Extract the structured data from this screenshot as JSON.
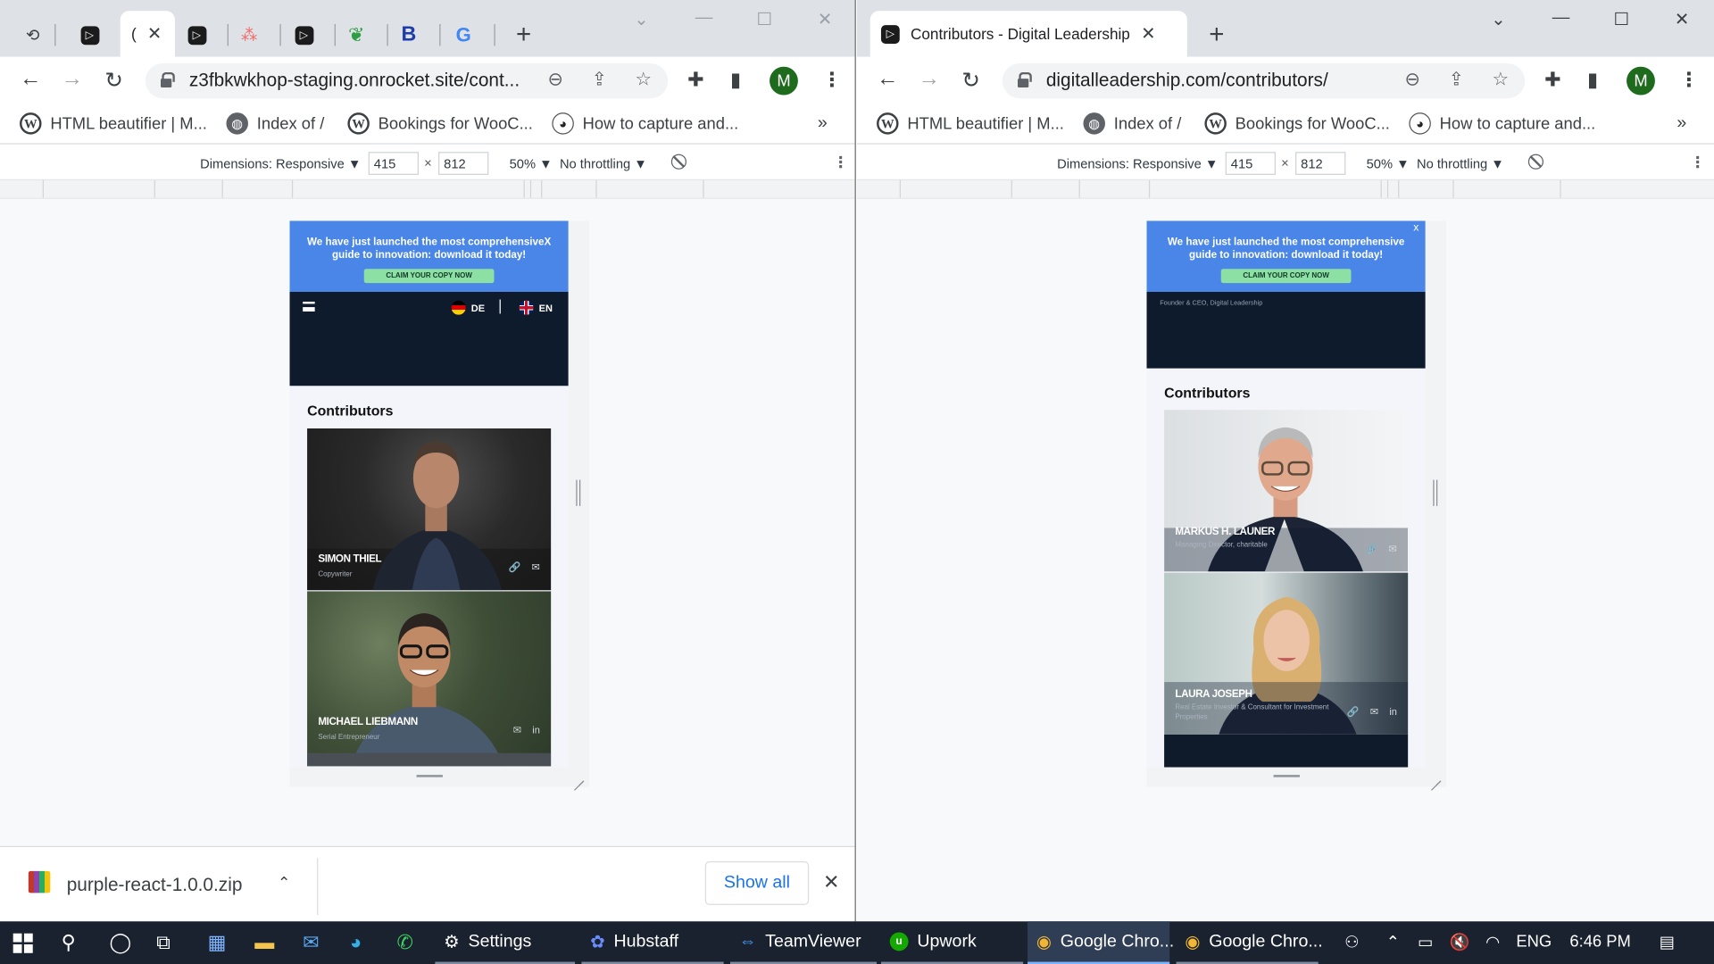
{
  "left_window": {
    "tabs": {
      "active_title": "(",
      "active_close": "✕",
      "bold_letter": "B",
      "g_letter": "G",
      "new_tab": "+"
    },
    "url": "z3fbkwkhop-staging.onrocket.site/cont...",
    "avatar_letter": "M",
    "bookmarks": [
      "HTML beautifier | M...",
      "Index of /",
      "Bookings for WooC...",
      "How to capture and..."
    ],
    "bookmark_more": "»",
    "devtools": {
      "dimensions": "Dimensions: Responsive ▼",
      "width": "415",
      "times": "×",
      "height": "812",
      "zoom": "50% ▼",
      "throttling": "No throttling ▼"
    },
    "page": {
      "banner_text": "We have just launched the most comprehensiveX guide to innovation: download it today!",
      "banner_button": "CLAIM YOUR COPY NOW",
      "lang_de": "DE",
      "lang_en": "EN",
      "section_title": "Contributors",
      "cards": [
        {
          "name": "SIMON THIEL",
          "role": "Copywriter",
          "icons": [
            "🔗",
            "✉"
          ]
        },
        {
          "name": "MICHAEL LIEBMANN",
          "role": "Serial Entrepreneur",
          "icons": [
            "✉",
            "in"
          ]
        }
      ]
    },
    "download": {
      "file": "purple-react-1.0.0.zip",
      "caret": "⌃",
      "show_all": "Show all",
      "close": "✕"
    }
  },
  "right_window": {
    "tabs": {
      "active_title": "Contributors - Digital Leadership",
      "active_close": "✕",
      "new_tab": "+"
    },
    "url": "digitalleadership.com/contributors/",
    "avatar_letter": "M",
    "bookmarks": [
      "HTML beautifier | M...",
      "Index of /",
      "Bookings for WooC...",
      "How to capture and..."
    ],
    "bookmark_more": "»",
    "devtools": {
      "dimensions": "Dimensions: Responsive ▼",
      "width": "415",
      "times": "×",
      "height": "812",
      "zoom": "50% ▼",
      "throttling": "No throttling ▼"
    },
    "page": {
      "banner_text": "We have just launched the most comprehensive guide to innovation: download it today!",
      "banner_button": "CLAIM YOUR COPY NOW",
      "banner_close": "x",
      "founder_text": "Founder & CEO, Digital Leadership",
      "section_title": "Contributors",
      "cards": [
        {
          "name": "MARKUS H. LAUNER",
          "role": "Managing Director, charitable",
          "icons": [
            "🔗",
            "✉"
          ]
        },
        {
          "name": "LAURA JOSEPH",
          "role": "Real Estate Investor & Consultant for Investment Properties",
          "icons": [
            "🔗",
            "✉",
            "in"
          ]
        }
      ]
    }
  },
  "taskbar": {
    "apps": [
      {
        "label": "Settings",
        "icon": "gear-icon"
      },
      {
        "label": "Hubstaff",
        "icon": "hubstaff-icon"
      },
      {
        "label": "TeamViewer",
        "icon": "teamviewer-icon"
      },
      {
        "label": "Upwork",
        "icon": "upwork-icon"
      },
      {
        "label": "Google Chro...",
        "icon": "chrome-icon"
      },
      {
        "label": "Google Chro...",
        "icon": "chrome-icon"
      }
    ],
    "language": "ENG",
    "time": "6:46 PM"
  },
  "colors": {
    "banner": "#4a86e8",
    "banner_button": "#8de0a3",
    "navbar": "#0e1b2d",
    "taskbar": "#1a2230",
    "link_blue": "#1a73e8"
  }
}
